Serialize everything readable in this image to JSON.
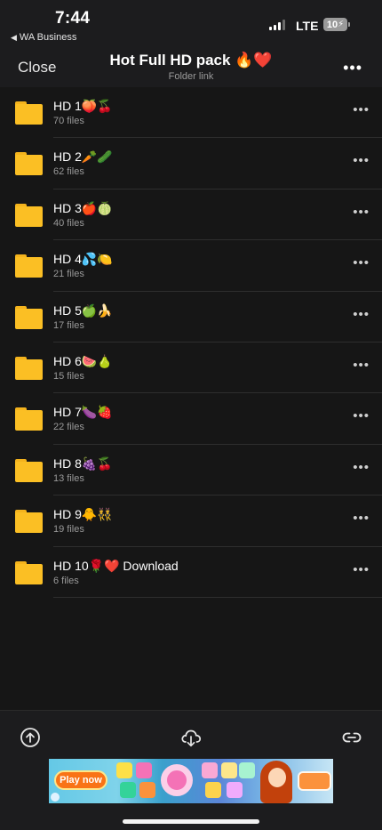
{
  "status": {
    "time": "7:44",
    "back_app": "WA Business",
    "network": "LTE",
    "battery": "10"
  },
  "header": {
    "close_label": "Close",
    "title": "Hot Full HD pack 🔥❤️",
    "subtitle": "Folder link",
    "more_icon": "more-horizontal-icon"
  },
  "folders": [
    {
      "name": "HD 1🍑🍒",
      "meta": "70 files"
    },
    {
      "name": "HD 2🥕🥒",
      "meta": "62 files"
    },
    {
      "name": "HD 3🍎🍈",
      "meta": "40 files"
    },
    {
      "name": "HD 4💦🍋",
      "meta": "21 files"
    },
    {
      "name": "HD 5🍏🍌",
      "meta": "17 files"
    },
    {
      "name": "HD 6🍉🍐",
      "meta": "15 files"
    },
    {
      "name": "HD 7🍆🍓",
      "meta": "22 files"
    },
    {
      "name": "HD 8🍇🍒",
      "meta": "13 files"
    },
    {
      "name": "HD 9🐥👯",
      "meta": "19 files"
    },
    {
      "name": "HD 10🌹❤️ Download",
      "meta": "6 files"
    }
  ],
  "toolbar": {
    "icons": [
      "upload-cloud-icon",
      "download-cloud-icon",
      "link-icon"
    ]
  },
  "ad": {
    "cta": "Play now"
  },
  "colors": {
    "folder": "#fbbf24",
    "background": "#161616",
    "header": "#1c1c1e"
  }
}
